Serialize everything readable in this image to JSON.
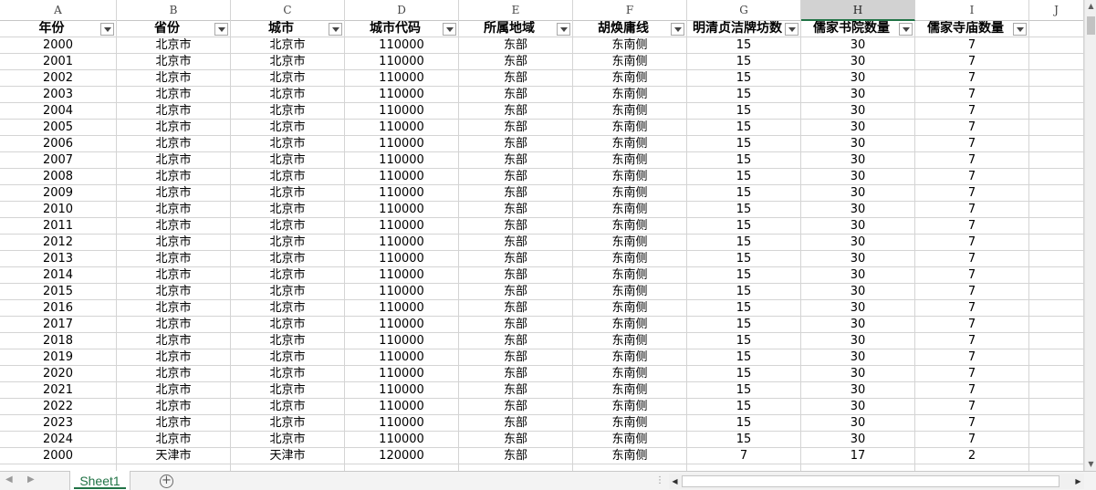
{
  "columns": [
    "A",
    "B",
    "C",
    "D",
    "E",
    "F",
    "G",
    "H",
    "I",
    "J"
  ],
  "selected_column": "H",
  "headers": [
    "年份",
    "省份",
    "城市",
    "城市代码",
    "所属地域",
    "胡焕庸线",
    "明清贞洁牌坊数",
    "儒家书院数量",
    "儒家寺庙数量"
  ],
  "rows": [
    [
      "2000",
      "北京市",
      "北京市",
      "110000",
      "东部",
      "东南侧",
      "15",
      "30",
      "7"
    ],
    [
      "2001",
      "北京市",
      "北京市",
      "110000",
      "东部",
      "东南侧",
      "15",
      "30",
      "7"
    ],
    [
      "2002",
      "北京市",
      "北京市",
      "110000",
      "东部",
      "东南侧",
      "15",
      "30",
      "7"
    ],
    [
      "2003",
      "北京市",
      "北京市",
      "110000",
      "东部",
      "东南侧",
      "15",
      "30",
      "7"
    ],
    [
      "2004",
      "北京市",
      "北京市",
      "110000",
      "东部",
      "东南侧",
      "15",
      "30",
      "7"
    ],
    [
      "2005",
      "北京市",
      "北京市",
      "110000",
      "东部",
      "东南侧",
      "15",
      "30",
      "7"
    ],
    [
      "2006",
      "北京市",
      "北京市",
      "110000",
      "东部",
      "东南侧",
      "15",
      "30",
      "7"
    ],
    [
      "2007",
      "北京市",
      "北京市",
      "110000",
      "东部",
      "东南侧",
      "15",
      "30",
      "7"
    ],
    [
      "2008",
      "北京市",
      "北京市",
      "110000",
      "东部",
      "东南侧",
      "15",
      "30",
      "7"
    ],
    [
      "2009",
      "北京市",
      "北京市",
      "110000",
      "东部",
      "东南侧",
      "15",
      "30",
      "7"
    ],
    [
      "2010",
      "北京市",
      "北京市",
      "110000",
      "东部",
      "东南侧",
      "15",
      "30",
      "7"
    ],
    [
      "2011",
      "北京市",
      "北京市",
      "110000",
      "东部",
      "东南侧",
      "15",
      "30",
      "7"
    ],
    [
      "2012",
      "北京市",
      "北京市",
      "110000",
      "东部",
      "东南侧",
      "15",
      "30",
      "7"
    ],
    [
      "2013",
      "北京市",
      "北京市",
      "110000",
      "东部",
      "东南侧",
      "15",
      "30",
      "7"
    ],
    [
      "2014",
      "北京市",
      "北京市",
      "110000",
      "东部",
      "东南侧",
      "15",
      "30",
      "7"
    ],
    [
      "2015",
      "北京市",
      "北京市",
      "110000",
      "东部",
      "东南侧",
      "15",
      "30",
      "7"
    ],
    [
      "2016",
      "北京市",
      "北京市",
      "110000",
      "东部",
      "东南侧",
      "15",
      "30",
      "7"
    ],
    [
      "2017",
      "北京市",
      "北京市",
      "110000",
      "东部",
      "东南侧",
      "15",
      "30",
      "7"
    ],
    [
      "2018",
      "北京市",
      "北京市",
      "110000",
      "东部",
      "东南侧",
      "15",
      "30",
      "7"
    ],
    [
      "2019",
      "北京市",
      "北京市",
      "110000",
      "东部",
      "东南侧",
      "15",
      "30",
      "7"
    ],
    [
      "2020",
      "北京市",
      "北京市",
      "110000",
      "东部",
      "东南侧",
      "15",
      "30",
      "7"
    ],
    [
      "2021",
      "北京市",
      "北京市",
      "110000",
      "东部",
      "东南侧",
      "15",
      "30",
      "7"
    ],
    [
      "2022",
      "北京市",
      "北京市",
      "110000",
      "东部",
      "东南侧",
      "15",
      "30",
      "7"
    ],
    [
      "2023",
      "北京市",
      "北京市",
      "110000",
      "东部",
      "东南侧",
      "15",
      "30",
      "7"
    ],
    [
      "2024",
      "北京市",
      "北京市",
      "110000",
      "东部",
      "东南侧",
      "15",
      "30",
      "7"
    ],
    [
      "2000",
      "天津市",
      "天津市",
      "120000",
      "东部",
      "东南侧",
      "7",
      "17",
      "2"
    ]
  ],
  "sheet_tab": "Sheet1",
  "add_sheet_symbol": "+",
  "icons": {
    "filter": "dropdown-filter-icon",
    "prev_sheet": "chevron-left-icon",
    "next_sheet": "chevron-right-icon",
    "add_sheet": "plus-circle-icon",
    "scroll_up": "triangle-up-icon",
    "scroll_down": "triangle-down-icon",
    "scroll_left": "triangle-left-icon",
    "scroll_right": "triangle-right-icon"
  },
  "colors": {
    "accent": "#217346",
    "grid": "#d4d4d4",
    "selected_header_bg": "#d2d2d2"
  }
}
